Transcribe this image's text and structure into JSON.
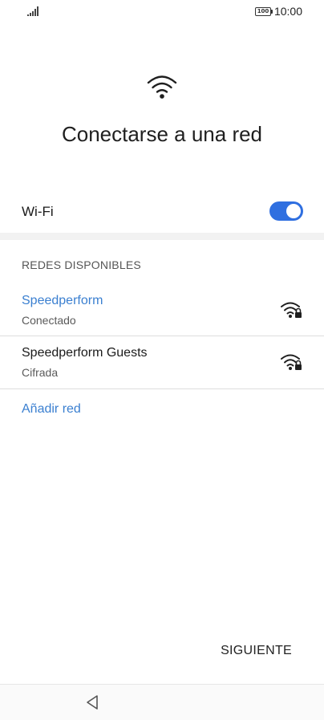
{
  "status_bar": {
    "battery_level": "100",
    "time": "10:00",
    "icons": [
      "signal-icon",
      "battery-icon"
    ]
  },
  "header": {
    "icon": "wifi-icon",
    "title": "Conectarse a una red"
  },
  "wifi_toggle": {
    "label": "Wi-Fi",
    "enabled": true
  },
  "networks_section": {
    "header": "REDES DISPONIBLES",
    "networks": [
      {
        "name": "Speedperform",
        "status": "Conectado",
        "connected": true,
        "icon": "wifi-lock-icon"
      },
      {
        "name": "Speedperform Guests",
        "status": "Cifrada",
        "connected": false,
        "icon": "wifi-lock-icon"
      }
    ],
    "add_network_label": "Añadir red"
  },
  "footer": {
    "next_label": "SIGUIENTE"
  },
  "nav_bar": {
    "icons": [
      "back-icon"
    ]
  },
  "colors": {
    "accent": "#2f6fe0",
    "link": "#3a7fd0",
    "text": "#1a1a1a",
    "secondary_text": "#5a5a5a"
  }
}
